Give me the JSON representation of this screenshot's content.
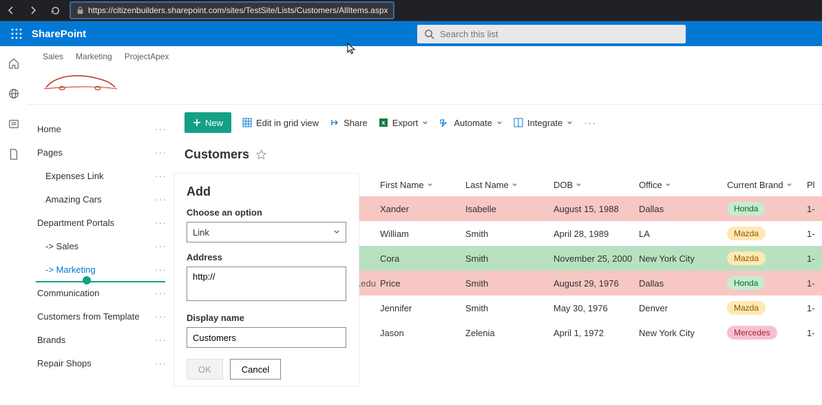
{
  "browser": {
    "url": "https://citizenbuilders.sharepoint.com/sites/TestSite/Lists/Customers/AllItems.aspx"
  },
  "suite": {
    "brand": "SharePoint",
    "search_placeholder": "Search this list"
  },
  "site_nav": {
    "items": [
      "Sales",
      "Marketing",
      "ProjectApex"
    ]
  },
  "left_nav": {
    "items": [
      {
        "label": "Home"
      },
      {
        "label": "Pages"
      },
      {
        "label": "Expenses Link",
        "sub": true
      },
      {
        "label": "Amazing Cars",
        "sub": true
      },
      {
        "label": "Department Portals"
      },
      {
        "label": "-> Sales",
        "sub": true
      },
      {
        "label": "-> Marketing",
        "sub": true,
        "selected": true
      },
      {
        "label": "Communication"
      },
      {
        "label": "Customers from Template"
      },
      {
        "label": "Brands"
      },
      {
        "label": "Repair Shops"
      }
    ]
  },
  "commands": {
    "new": "New",
    "edit": "Edit in grid view",
    "share": "Share",
    "export": "Export",
    "automate": "Automate",
    "integrate": "Integrate"
  },
  "list": {
    "title": "Customers",
    "columns": {
      "first_name": "First Name",
      "last_name": "Last Name",
      "dob": "DOB",
      "office": "Office",
      "brand": "Current Brand",
      "last": "Pl"
    },
    "rows": [
      {
        "email": "",
        "fn": "Xander",
        "ln": "Isabelle",
        "dob": "August 15, 1988",
        "office": "Dallas",
        "brand": "Honda",
        "brand_cls": "honda",
        "row_cls": "r-pink",
        "trail": "1-"
      },
      {
        "email": "",
        "fn": "William",
        "ln": "Smith",
        "dob": "April 28, 1989",
        "office": "LA",
        "brand": "Mazda",
        "brand_cls": "mazda",
        "row_cls": "",
        "trail": "1-"
      },
      {
        "email": "",
        "fn": "Cora",
        "ln": "Smith",
        "dob": "November 25, 2000",
        "office": "New York City",
        "brand": "Mazda",
        "brand_cls": "mazda",
        "row_cls": "r-green",
        "trail": "1-",
        "comment": true
      },
      {
        "email": ".edu",
        "fn": "Price",
        "ln": "Smith",
        "dob": "August 29, 1976",
        "office": "Dallas",
        "brand": "Honda",
        "brand_cls": "honda",
        "row_cls": "r-pink",
        "trail": "1-"
      },
      {
        "email": "",
        "fn": "Jennifer",
        "ln": "Smith",
        "dob": "May 30, 1976",
        "office": "Denver",
        "brand": "Mazda",
        "brand_cls": "mazda",
        "row_cls": "",
        "trail": "1-"
      },
      {
        "email": "",
        "fn": "Jason",
        "ln": "Zelenia",
        "dob": "April 1, 1972",
        "office": "New York City",
        "brand": "Mercedes",
        "brand_cls": "merc",
        "row_cls": "",
        "trail": "1-"
      }
    ]
  },
  "panel": {
    "title": "Add",
    "choose_label": "Choose an option",
    "choose_value": "Link",
    "address_label": "Address",
    "address_value": "http://",
    "display_label": "Display name",
    "display_value": "Customers",
    "ok": "OK",
    "cancel": "Cancel"
  }
}
